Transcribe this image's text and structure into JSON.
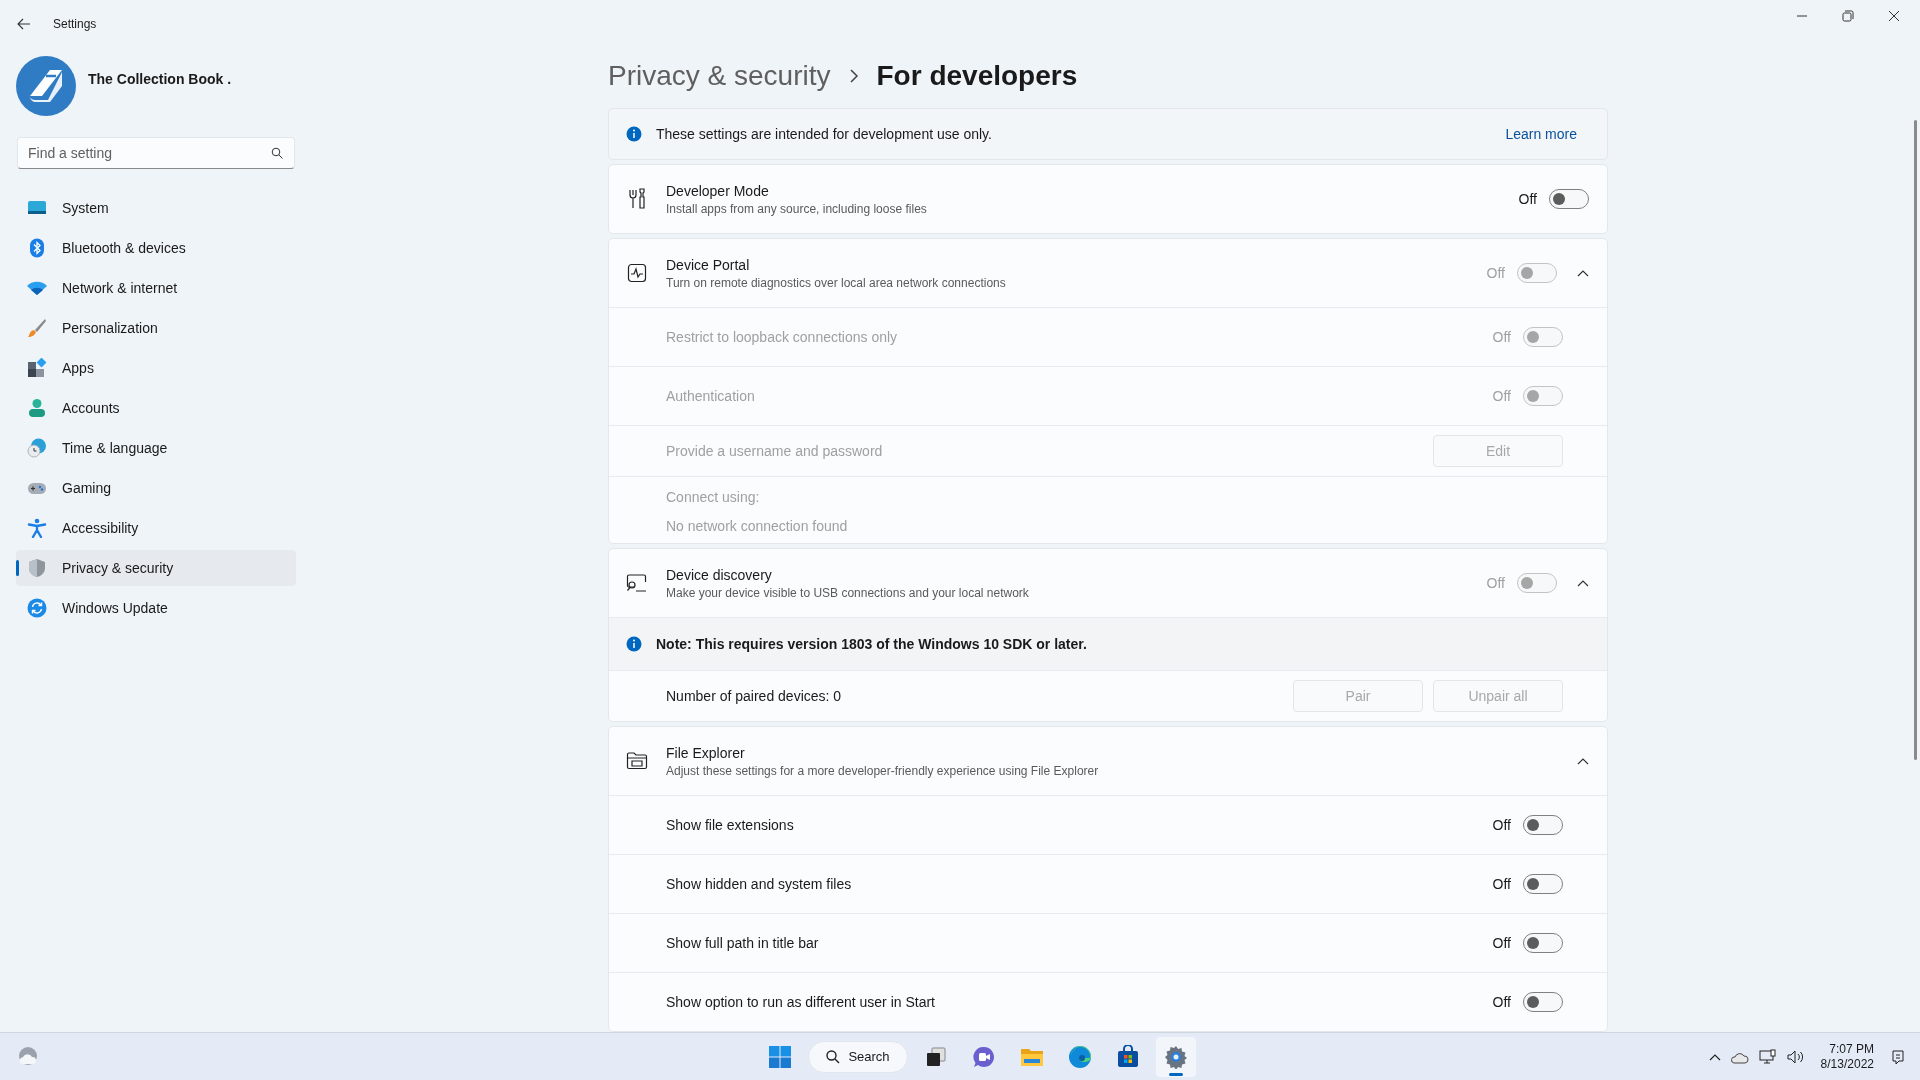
{
  "window": {
    "title": "Settings"
  },
  "profile": {
    "name": "The Collection Book ."
  },
  "search": {
    "placeholder": "Find a setting"
  },
  "sidebar": {
    "items": [
      {
        "label": "System",
        "selected": false
      },
      {
        "label": "Bluetooth & devices",
        "selected": false
      },
      {
        "label": "Network & internet",
        "selected": false
      },
      {
        "label": "Personalization",
        "selected": false
      },
      {
        "label": "Apps",
        "selected": false
      },
      {
        "label": "Accounts",
        "selected": false
      },
      {
        "label": "Time & language",
        "selected": false
      },
      {
        "label": "Gaming",
        "selected": false
      },
      {
        "label": "Accessibility",
        "selected": false
      },
      {
        "label": "Privacy & security",
        "selected": true
      },
      {
        "label": "Windows Update",
        "selected": false
      }
    ]
  },
  "breadcrumb": [
    "Privacy & security",
    "For developers"
  ],
  "sections": [
    {
      "kind": "info",
      "text": "These settings are intended for development use only.",
      "link": "Learn more"
    },
    {
      "kind": "setting",
      "title": "Developer Mode",
      "description": "Install apps from any source, including loose files",
      "toggle": {
        "label": "Off",
        "on": false,
        "disabled": false
      }
    },
    {
      "kind": "expander",
      "title": "Device Portal",
      "description": "Turn on remote diagnostics over local area network connections",
      "expanded": true,
      "toggle": {
        "label": "Off",
        "on": false,
        "disabled": true
      },
      "children": [
        {
          "kind": "toggle",
          "label": "Restrict to loopback connections only",
          "disabled": true,
          "toggle": {
            "label": "Off",
            "on": false,
            "disabled": true
          }
        },
        {
          "kind": "toggle",
          "label": "Authentication",
          "disabled": true,
          "toggle": {
            "label": "Off",
            "on": false,
            "disabled": true
          }
        },
        {
          "kind": "buttons",
          "label": "Provide a username and password",
          "disabled": true,
          "buttons": [
            {
              "label": "Edit",
              "disabled": true
            }
          ]
        },
        {
          "kind": "lines",
          "disabled": true,
          "lines": [
            "Connect using:",
            "No network connection found"
          ]
        }
      ]
    },
    {
      "kind": "expander",
      "title": "Device discovery",
      "description": "Make your device visible to USB connections and your local network",
      "expanded": true,
      "toggle": {
        "label": "Off",
        "on": false,
        "disabled": true
      },
      "children": [
        {
          "kind": "note",
          "text": "Note: This requires version 1803 of the Windows 10 SDK or later."
        },
        {
          "kind": "buttons",
          "label": "Number of paired devices: 0",
          "disabled": false,
          "buttons": [
            {
              "label": "Pair",
              "disabled": true
            },
            {
              "label": "Unpair all",
              "disabled": true
            }
          ]
        }
      ]
    },
    {
      "kind": "expander",
      "title": "File Explorer",
      "description": "Adjust these settings for a more developer-friendly experience using File Explorer",
      "expanded": true,
      "children": [
        {
          "kind": "toggle",
          "label": "Show file extensions",
          "disabled": false,
          "toggle": {
            "label": "Off",
            "on": false,
            "disabled": false
          }
        },
        {
          "kind": "toggle",
          "label": "Show hidden and system files",
          "disabled": false,
          "toggle": {
            "label": "Off",
            "on": false,
            "disabled": false
          }
        },
        {
          "kind": "toggle",
          "label": "Show full path in title bar",
          "disabled": false,
          "toggle": {
            "label": "Off",
            "on": false,
            "disabled": false
          }
        },
        {
          "kind": "toggle",
          "label": "Show option to run as different user in Start",
          "disabled": false,
          "toggle": {
            "label": "Off",
            "on": false,
            "disabled": false
          }
        }
      ]
    }
  ],
  "taskbar": {
    "search": "Search",
    "apps": [
      {
        "selected": false
      },
      {
        "selected": false
      },
      {
        "selected": false
      },
      {
        "selected": false
      },
      {
        "selected": false
      },
      {
        "selected": true
      }
    ],
    "time": "7:07 PM",
    "date": "8/13/2022"
  }
}
